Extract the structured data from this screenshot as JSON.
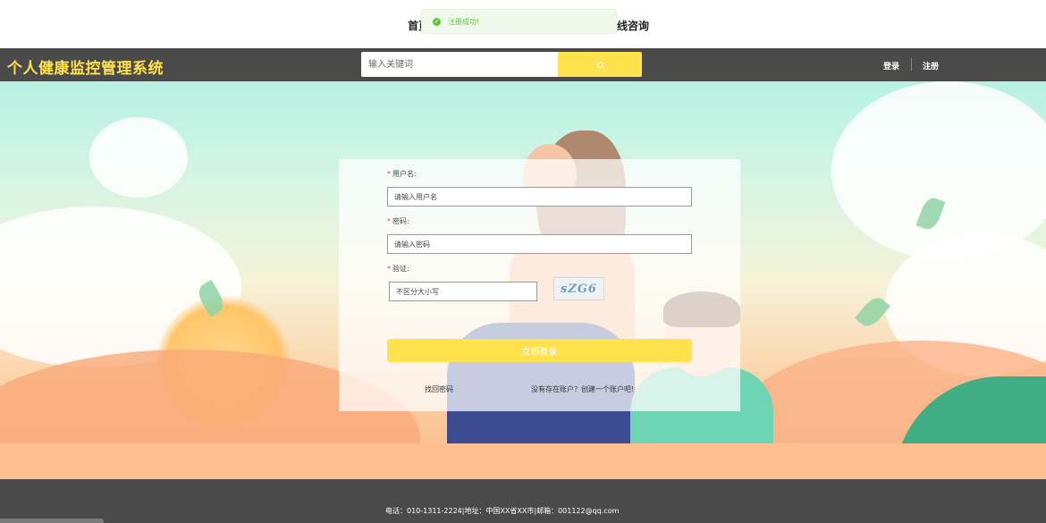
{
  "nav": {
    "left_partial": "首页",
    "right_partial": "线咨询"
  },
  "toast": {
    "message": "注册成功!",
    "color": "#67c23a"
  },
  "header": {
    "brand": "个人健康监控管理系统",
    "search_placeholder": "输入关键词",
    "search_icon": "search-icon",
    "login": "登录",
    "register": "注册",
    "brand_color": "#ffe24d"
  },
  "form": {
    "username_label": "用户名:",
    "username_placeholder": "请输入用户名",
    "password_label": "密码:",
    "password_placeholder": "请输入密码",
    "captcha_label": "验证:",
    "captcha_placeholder": "不区分大小写",
    "captcha_text": "sZG6",
    "login_button": "立即登录",
    "forgot_link": "找回密码",
    "signup_link": "没有存在账户？创建一个账户吧!",
    "required_mark": "*"
  },
  "footer": {
    "contact": "电话：010-1311-2224|地址：中国XX省XX市|邮箱：001122@qq.com"
  }
}
